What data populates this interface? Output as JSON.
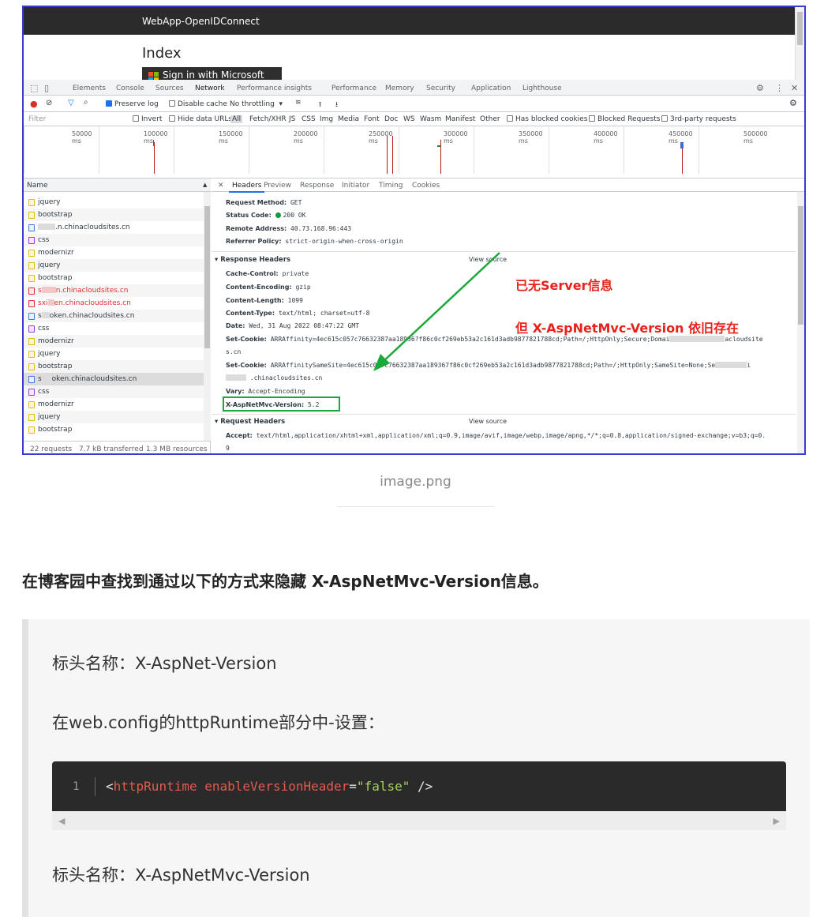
{
  "screenshot": {
    "app": {
      "title": "WebApp-OpenIDConnect",
      "page_heading": "Index",
      "signin_label": "Sign in with Microsoft"
    },
    "devtools": {
      "tabs": [
        "Elements",
        "Console",
        "Sources",
        "Network",
        "Performance insights",
        "Performance",
        "Memory",
        "Security",
        "Application",
        "Lighthouse"
      ],
      "active_tab": "Network",
      "toolbar": {
        "preserve_log": "Preserve log",
        "disable_cache": "Disable cache",
        "throttling": "No throttling"
      },
      "filter": {
        "placeholder": "Filter",
        "invert": "Invert",
        "hide_data_urls": "Hide data URLs",
        "types": [
          "All",
          "Fetch/XHR",
          "JS",
          "CSS",
          "Img",
          "Media",
          "Font",
          "Doc",
          "WS",
          "Wasm",
          "Manifest",
          "Other"
        ],
        "has_blocked_cookies": "Has blocked cookies",
        "blocked_requests": "Blocked Requests",
        "third_party": "3rd-party requests"
      },
      "timeline_labels": [
        "50000 ms",
        "100000 ms",
        "150000 ms",
        "200000 ms",
        "250000 ms",
        "300000 ms",
        "350000 ms",
        "400000 ms",
        "450000 ms",
        "500000 ms"
      ],
      "requests": {
        "column_name": "Name",
        "items": [
          {
            "name": "jquery",
            "type": "js"
          },
          {
            "name": "bootstrap",
            "type": "js"
          },
          {
            "name": ".n.chinacloudsites.cn",
            "type": "doc"
          },
          {
            "name": "css",
            "type": "css"
          },
          {
            "name": "modernizr",
            "type": "js"
          },
          {
            "name": "jquery",
            "type": "js"
          },
          {
            "name": "bootstrap",
            "type": "js"
          },
          {
            "name": "n.chinacloudsites.cn",
            "type": "bad",
            "prefix": "s"
          },
          {
            "name": "en.chinacloudsites.cn",
            "type": "bad",
            "prefix": "sxi"
          },
          {
            "name": "oken.chinacloudsites.cn",
            "type": "doc",
            "prefix": "s"
          },
          {
            "name": "css",
            "type": "css"
          },
          {
            "name": "modernizr",
            "type": "js"
          },
          {
            "name": "jquery",
            "type": "js"
          },
          {
            "name": "bootstrap",
            "type": "js"
          },
          {
            "name": "oken.chinacloudsites.cn",
            "type": "doc",
            "prefix": "s",
            "selected": true
          },
          {
            "name": "css",
            "type": "css"
          },
          {
            "name": "modernizr",
            "type": "js"
          },
          {
            "name": "jquery",
            "type": "js"
          },
          {
            "name": "bootstrap",
            "type": "js"
          }
        ],
        "status_requests": "22 requests",
        "status_transferred": "7.7 kB transferred",
        "status_resources": "1.3 MB resources"
      },
      "detail_tabs": [
        "Headers",
        "Preview",
        "Response",
        "Initiator",
        "Timing",
        "Cookies"
      ],
      "general": {
        "request_method_label": "Request Method:",
        "request_method": "GET",
        "status_code_label": "Status Code:",
        "status_code": "200 OK",
        "remote_address_label": "Remote Address:",
        "remote_address": "40.73.168.96:443",
        "referrer_policy_label": "Referrer Policy:",
        "referrer_policy": "strict-origin-when-cross-origin"
      },
      "response_headers": {
        "title": "Response Headers",
        "view_source": "View source",
        "cache_control_label": "Cache-Control:",
        "cache_control": "private",
        "content_encoding_label": "Content-Encoding:",
        "content_encoding": "gzip",
        "content_length_label": "Content-Length:",
        "content_length": "1099",
        "content_type_label": "Content-Type:",
        "content_type": "text/html; charset=utf-8",
        "date_label": "Date:",
        "date": "Wed, 31 Aug 2022 08:47:22 GMT",
        "set_cookie_label": "Set-Cookie:",
        "set_cookie_1": "ARRAffinity=4ec615c057c76632387aa18936?f86c0cf269eb53a2c161d3adb9877821788cd;Path=/;HttpOnly;Secure;Domai",
        "set_cookie_1_end": "acloudsite",
        "set_cookie_1_wrap": "s.cn",
        "set_cookie_2": "ARRAffinitySameSite=4ec615c057c76632387aa189367f86c0cf269eb53a2c161d3adb9877821788cd;Path=/;HttpOnly;SameSite=None;Se",
        "set_cookie_2_end": "i",
        "set_cookie_2_wrap": ".chinacloudsites.cn",
        "vary_label": "Vary:",
        "vary": "Accept-Encoding",
        "mvc_label": "X-AspNetMvc-Version:",
        "mvc": "5.2"
      },
      "request_headers": {
        "title": "Request Headers",
        "view_source": "View source",
        "accept_label": "Accept:",
        "accept": "text/html,application/xhtml+xml,application/xml;q=0.9,image/avif,image/webp,image/apng,*/*;q=0.8,application/signed-exchange;v=b3;q=0.",
        "accept_wrap": "9"
      }
    },
    "annotations": {
      "no_server": "已无Server信息",
      "still_exists": "但 X-AspNetMvc-Version 依旧存在"
    }
  },
  "caption": "image.png",
  "article": {
    "heading": "在博客园中查找到通过以下的方式来隐藏 X-AspNetMvc-Version信息。",
    "p1": "标头名称：X-AspNet-Version",
    "p2": "在web.config的httpRuntime部分中-设置：",
    "code": {
      "line_number": "1",
      "open": "<",
      "tag": "httpRuntime",
      "attr": "enableVersionHeader",
      "eq": "=",
      "value": "\"false\"",
      "close": " />"
    },
    "p3": "标头名称：X-AspNetMvc-Version"
  }
}
